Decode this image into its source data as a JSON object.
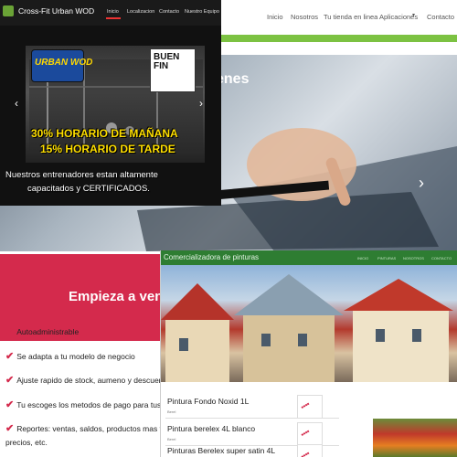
{
  "back_site": {
    "nav": [
      "Inicio",
      "Nosotros",
      "Tu tienda en linea",
      "Aplicaciones",
      "Contacto"
    ],
    "hero_title_fragment": "enes",
    "cta": "Empieza a ven",
    "features": [
      "Autoadministrable",
      "Se adapta a tu modelo de negocio",
      "Ajuste rapido de stock, aumeno y descuentos",
      "Tu escoges los metodos de pago para tus client",
      "Reportes:  ventas,  saldos,  productos  mas  ve",
      "precios, etc."
    ],
    "accent_color": "#d42a4c",
    "green_color": "#7cc242"
  },
  "crossfit": {
    "title": "Cross-Fit Urban WOD",
    "nav": [
      "Inicio",
      "Localizacion",
      "Contacto",
      "Nuestro Equipo"
    ],
    "badge": "URBAN WOD",
    "black_friday": [
      "BUEN",
      "FIN"
    ],
    "promo1": "30% HORARIO DE MAÑANA",
    "promo2": "15% HORARIO DE TARDE",
    "sub1": "Nuestros entrenadores estan altamente",
    "sub2": "capacitados y CERTIFICADOS."
  },
  "pinturas": {
    "title": "Comercializadora de pinturas",
    "nav": [
      "INICIO",
      "PINTURAS",
      "NOSOTROS",
      "CONTACTO"
    ],
    "products": [
      {
        "name": "Pintura Fondo Noxid 1L",
        "cat": "Berel"
      },
      {
        "name": "Pintura berelex 4L blanco",
        "cat": "Berel"
      },
      {
        "name": "Pinturas Berelex super satin 4L",
        "cat": ""
      }
    ]
  }
}
